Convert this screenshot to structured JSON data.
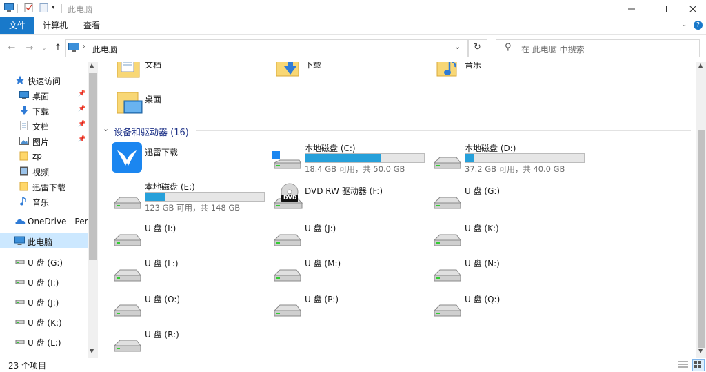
{
  "window": {
    "title": "此电脑",
    "minimize_icon": "minimize-icon",
    "maximize_icon": "maximize-icon",
    "close_icon": "close-icon"
  },
  "ribbon": {
    "tabs": [
      {
        "label": "文件"
      },
      {
        "label": "计算机"
      },
      {
        "label": "查看"
      }
    ]
  },
  "address": {
    "path": "此电脑",
    "search_placeholder": "在 此电脑 中搜索"
  },
  "sidebar": {
    "quick_access": "快速访问",
    "items": [
      {
        "label": "桌面",
        "icon": "desktop-icon",
        "pinned": true
      },
      {
        "label": "下载",
        "icon": "download-icon",
        "pinned": true
      },
      {
        "label": "文档",
        "icon": "document-icon",
        "pinned": true
      },
      {
        "label": "图片",
        "icon": "picture-icon",
        "pinned": true
      },
      {
        "label": "zp",
        "icon": "folder-icon",
        "pinned": false
      },
      {
        "label": "视频",
        "icon": "video-icon",
        "pinned": false
      },
      {
        "label": "迅雷下载",
        "icon": "folder-icon",
        "pinned": false
      },
      {
        "label": "音乐",
        "icon": "music-icon",
        "pinned": false
      }
    ],
    "onedrive": "OneDrive - Perso",
    "this_pc": "此电脑",
    "drives": [
      {
        "label": "U 盘 (G:)"
      },
      {
        "label": "U 盘 (I:)"
      },
      {
        "label": "U 盘 (J:)"
      },
      {
        "label": "U 盘 (K:)"
      },
      {
        "label": "U 盘 (L:)"
      }
    ]
  },
  "folders": [
    {
      "label": "文档"
    },
    {
      "label": "下载"
    },
    {
      "label": "音乐"
    },
    {
      "label": "桌面"
    }
  ],
  "devices": {
    "title": "设备和驱动器 (16)",
    "xunlei": "迅雷下载",
    "disk_c": {
      "label": "本地磁盘 (C:)",
      "info": "18.4 GB 可用，共 50.0 GB",
      "used_fraction": 0.632
    },
    "disk_d": {
      "label": "本地磁盘 (D:)",
      "info": "37.2 GB 可用，共 40.0 GB",
      "used_fraction": 0.07
    },
    "disk_e": {
      "label": "本地磁盘 (E:)",
      "info": "123 GB 可用，共 148 GB",
      "used_fraction": 0.169
    },
    "dvd": {
      "label": "DVD RW 驱动器 (F:)",
      "badge": "DVD"
    },
    "usb": [
      {
        "label": "U 盘 (G:)"
      },
      {
        "label": "U 盘 (I:)"
      },
      {
        "label": "U 盘 (J:)"
      },
      {
        "label": "U 盘 (K:)"
      },
      {
        "label": "U 盘 (L:)"
      },
      {
        "label": "U 盘 (M:)"
      },
      {
        "label": "U 盘 (N:)"
      },
      {
        "label": "U 盘 (O:)"
      },
      {
        "label": "U 盘 (P:)"
      },
      {
        "label": "U 盘 (Q:)"
      },
      {
        "label": "U 盘 (R:)"
      }
    ]
  },
  "status": {
    "count": "23 个项目"
  },
  "colors": {
    "accent": "#1979ca",
    "bar": "#26a0da",
    "section": "#1e3287"
  }
}
